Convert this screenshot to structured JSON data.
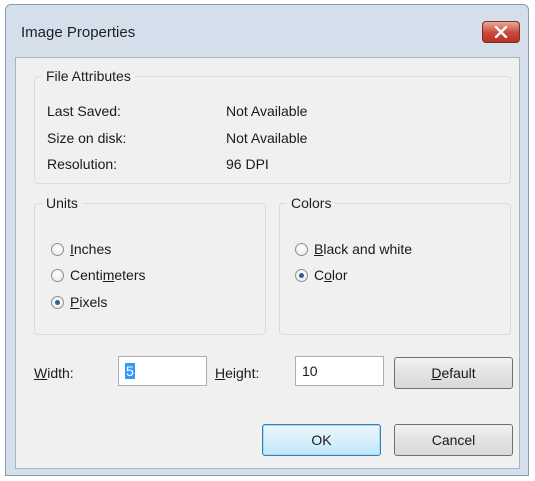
{
  "window": {
    "title": "Image Properties",
    "close_icon": "close-icon"
  },
  "file_attributes": {
    "legend": "File Attributes",
    "rows": [
      {
        "label": "Last Saved:",
        "value": "Not Available"
      },
      {
        "label": "Size on disk:",
        "value": "Not Available"
      },
      {
        "label": "Resolution:",
        "value": "96 DPI"
      }
    ]
  },
  "units": {
    "legend": "Units",
    "options": [
      {
        "pre": "",
        "u": "I",
        "post": "nches",
        "checked": false
      },
      {
        "pre": "Centi",
        "u": "m",
        "post": "eters",
        "checked": false
      },
      {
        "pre": "",
        "u": "P",
        "post": "ixels",
        "checked": true
      }
    ]
  },
  "colors": {
    "legend": "Colors",
    "options": [
      {
        "pre": "",
        "u": "B",
        "post": "lack and white",
        "checked": false
      },
      {
        "pre": "C",
        "u": "o",
        "post": "lor",
        "checked": true
      }
    ]
  },
  "size": {
    "width_label_u": "W",
    "width_label_rest": "idth:",
    "width_value": "5",
    "height_label_u": "H",
    "height_label_rest": "eight:",
    "height_value": "10"
  },
  "buttons": {
    "default_u": "D",
    "default_rest": "efault",
    "ok": "OK",
    "cancel": "Cancel"
  },
  "colors_theme": {
    "title_bar": "#d5dfec",
    "client_bg": "#f0f0f0",
    "close_button": "#c9463a",
    "focus_border": "#3c7fb1"
  }
}
